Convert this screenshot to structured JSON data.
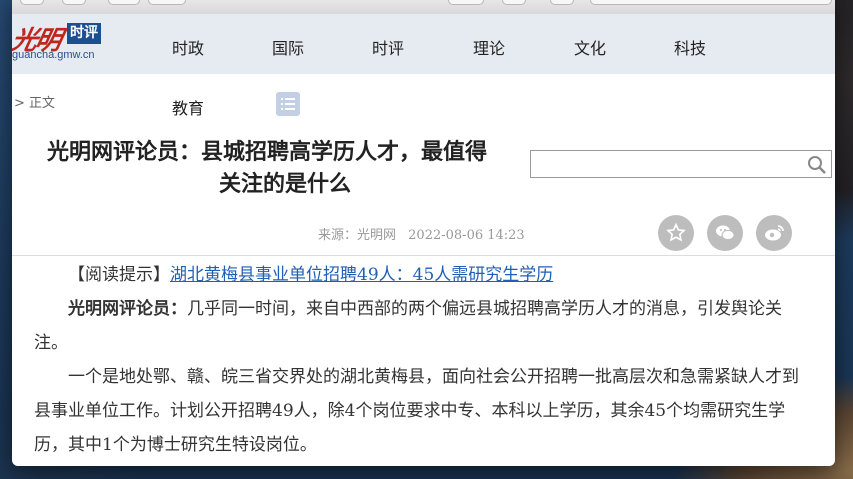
{
  "site": {
    "logo_text": "光明",
    "logo_badge": "时评",
    "logo_url": "guancha.gmw.cn"
  },
  "nav": {
    "items": [
      "时政",
      "国际",
      "时评",
      "理论",
      "文化",
      "科技"
    ],
    "row2": "教育",
    "breadcrumb": "> 正文"
  },
  "article": {
    "title_line1": "光明网评论员：县城招聘高学历人才，最值得",
    "title_line2": "关注的是什么",
    "source_label": "来源：光明网",
    "date": "2022-08-06 14:23",
    "tip_label": "【阅读提示】",
    "tip_link": "湖北黄梅县事业单位招聘49人：45人需研究生学历",
    "p1_lead": "光明网评论员：",
    "p1_body": "几乎同一时间，来自中西部的两个偏远县城招聘高学历人才的消息，引发舆论关注。",
    "p2": "一个是地处鄂、赣、皖三省交界处的湖北黄梅县，面向社会公开招聘一批高层次和急需紧缺人才到县事业单位工作。计划公开招聘49人，除4个岗位要求中专、本科以上学历，其余45个均需研究生学历，其中1个为博士研究生特设岗位。"
  },
  "search": {
    "value": "",
    "icon": "search-icon"
  },
  "share": [
    "star-icon",
    "wechat-icon",
    "weibo-icon"
  ],
  "colors": {
    "nav_bg": "#e6ebf1",
    "logo_red": "#c0261d",
    "logo_blue": "#1c4f91",
    "link": "#1f5fb5"
  }
}
